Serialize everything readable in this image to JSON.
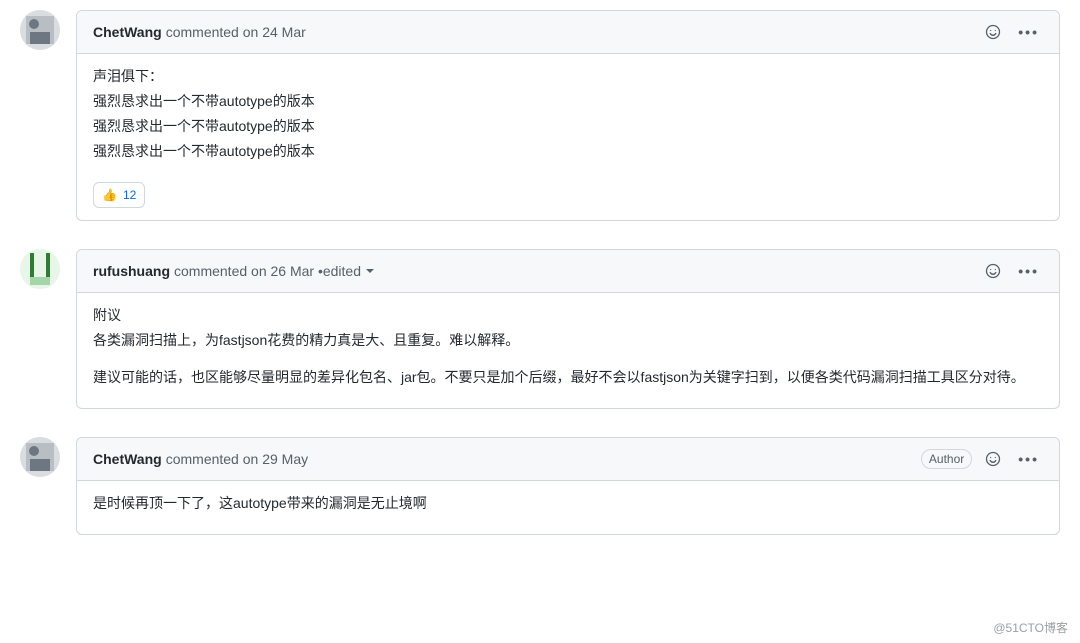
{
  "comments": [
    {
      "author": "ChetWang",
      "meta": " commented on 24 Mar",
      "body": [
        "声泪俱下：",
        "强烈恳求出一个不带autotype的版本",
        "强烈恳求出一个不带autotype的版本",
        "强烈恳求出一个不带autotype的版本"
      ],
      "reaction_emoji": "👍",
      "reaction_count": "12"
    },
    {
      "author": "rufushuang",
      "meta": " commented on 26 Mar • ",
      "edited": "edited",
      "body_p1": "附议",
      "body_p2": "各类漏洞扫描上，为fastjson花费的精力真是大、且重复。难以解释。",
      "body_p3": "建议可能的话，也区能够尽量明显的差异化包名、jar包。不要只是加个后缀，最好不会以fastjson为关键字扫到，以便各类代码漏洞扫描工具区分对待。"
    },
    {
      "author": "ChetWang",
      "meta": " commented on 29 May",
      "author_badge": "Author",
      "body": "是时候再顶一下了，这autotype带来的漏洞是无止境啊"
    }
  ],
  "watermark": "@51CTO博客"
}
